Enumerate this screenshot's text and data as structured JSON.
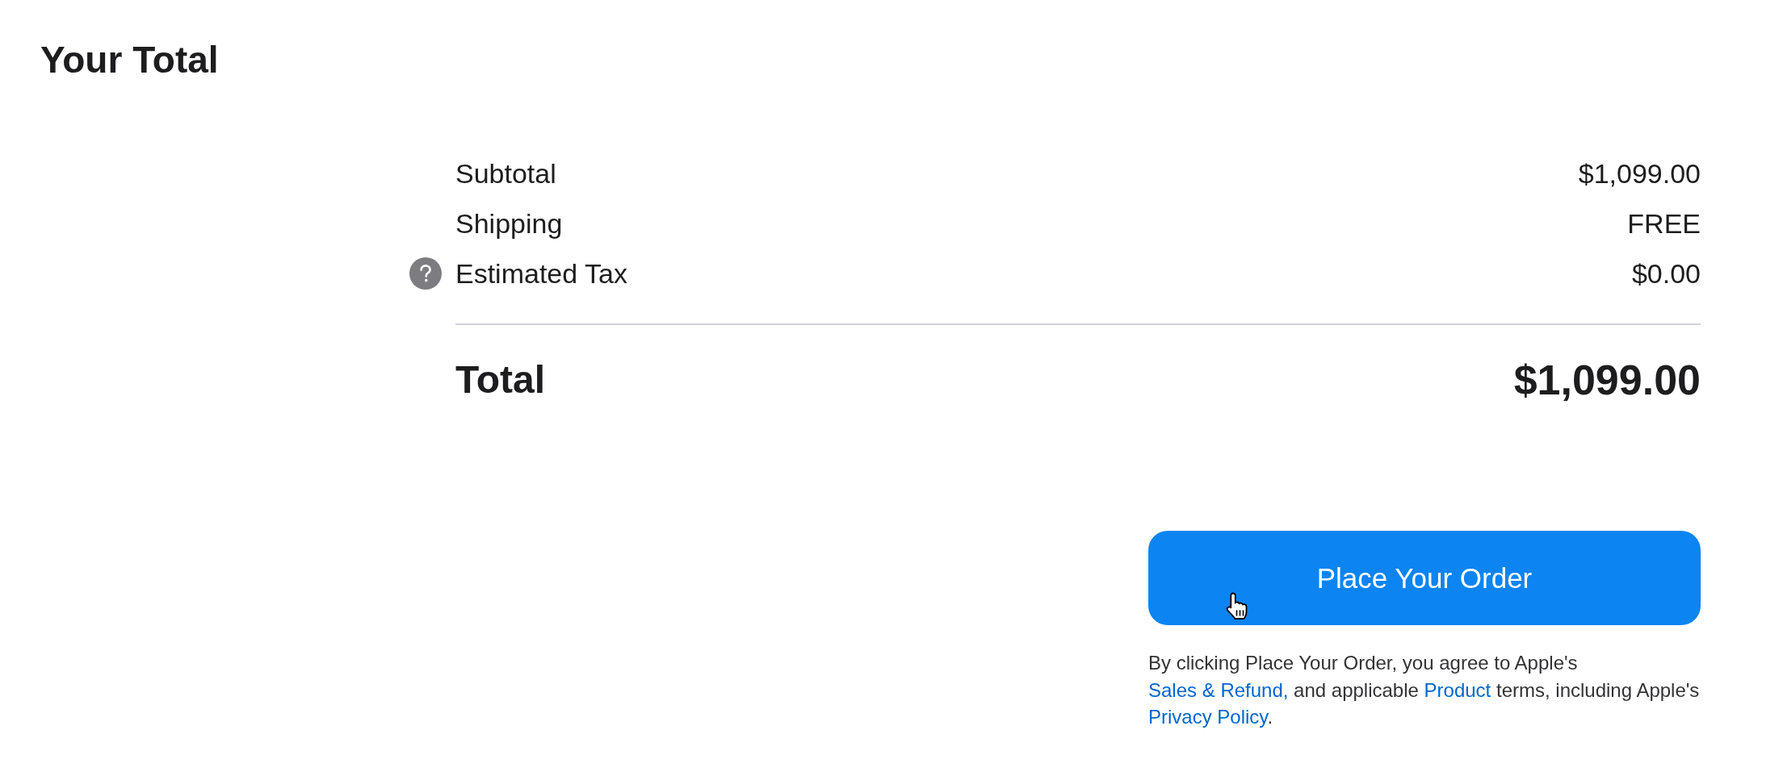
{
  "title": "Your Total",
  "summary": {
    "rows": [
      {
        "label": "Subtotal",
        "value": "$1,099.00",
        "help": false
      },
      {
        "label": "Shipping",
        "value": "FREE",
        "help": false
      },
      {
        "label": "Estimated Tax",
        "value": "$0.00",
        "help": true
      }
    ],
    "total": {
      "label": "Total",
      "value": "$1,099.00"
    }
  },
  "order_button": {
    "label": "Place Your Order"
  },
  "legal": {
    "segments": [
      {
        "kind": "text",
        "text": "By clicking Place Your Order, you agree to Apple's "
      },
      {
        "kind": "link",
        "text": "Sales & Refund,"
      },
      {
        "kind": "text",
        "text": " and applicable "
      },
      {
        "kind": "link",
        "text": "Product"
      },
      {
        "kind": "text",
        "text": " terms, including Apple's "
      },
      {
        "kind": "link",
        "text": "Privacy Policy"
      },
      {
        "kind": "text",
        "text": "."
      }
    ]
  }
}
